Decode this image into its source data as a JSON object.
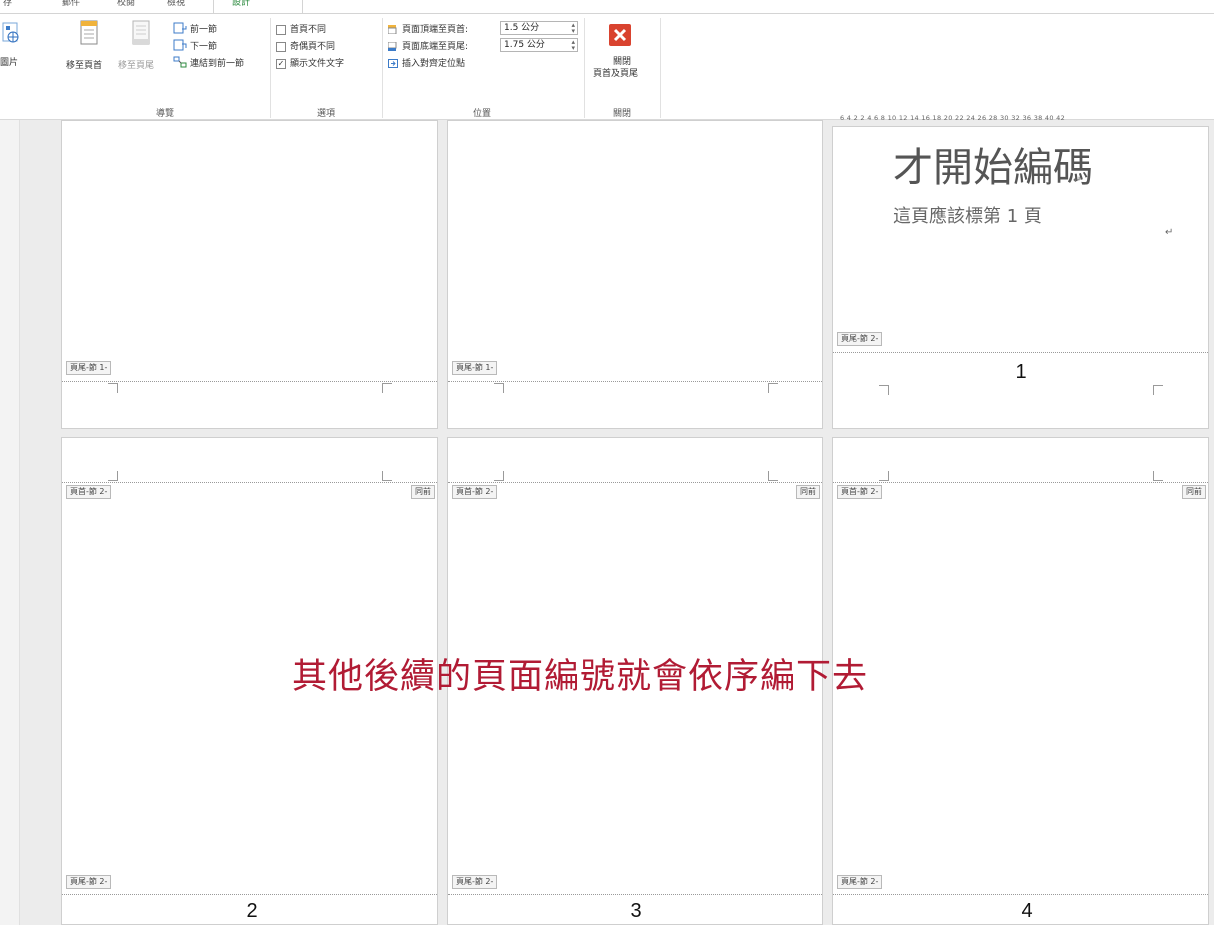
{
  "ribbon": {
    "tabs": [
      "存",
      "郵件",
      "校閱",
      "檢視",
      "設計"
    ],
    "active_tab": "設計",
    "picture_label": "圖片",
    "navigation": {
      "goto_header": "移至頁首",
      "goto_footer": "移至頁尾",
      "previous": "前一節",
      "next": "下一節",
      "link_previous": "連結到前一節",
      "group": "導覽"
    },
    "options": {
      "different_first": "首頁不同",
      "different_odd_even": "奇偶頁不同",
      "show_doc_text": "顯示文件文字",
      "show_doc_text_checked": true,
      "group": "選項"
    },
    "position": {
      "header_top_label": "頁面頂端至頁首:",
      "header_top_value": "1.5 公分",
      "footer_bottom_label": "頁面底端至頁尾:",
      "footer_bottom_value": "1.75 公分",
      "insert_tab": "插入對齊定位點",
      "group": "位置"
    },
    "close": {
      "button_line1": "關閉",
      "button_line2": "頁首及頁尾",
      "group": "關閉"
    }
  },
  "ruler_text": "6 4 2  2 4 6 8 10 12 14 16 18 20 22 24 26 28 30 32   36 38 40 42",
  "pages": {
    "p1": {
      "footer_tag": "頁尾-節 1-"
    },
    "p2": {
      "footer_tag": "頁尾-節 1-"
    },
    "p3": {
      "title": "才開始編碼",
      "subtitle": "這頁應該標第 1 頁",
      "footer_tag": "頁尾-節 2-",
      "page_number": "1"
    },
    "p4": {
      "header_tag": "頁首-節 2-",
      "same_as_prev": "同前",
      "footer_tag": "頁尾-節 2-",
      "page_number": "2"
    },
    "p5": {
      "header_tag": "頁首-節 2-",
      "same_as_prev": "同前",
      "footer_tag": "頁尾-節 2-",
      "page_number": "3"
    },
    "p6": {
      "header_tag": "頁首-節 2-",
      "same_as_prev": "同前",
      "footer_tag": "頁尾-節 2-",
      "page_number": "4"
    }
  },
  "overlay_text": "其他後續的頁面編號就會依序編下去",
  "colors": {
    "accent_green": "#2b8a3e",
    "close_red": "#d9432f",
    "overlay_red": "#b11b34"
  }
}
